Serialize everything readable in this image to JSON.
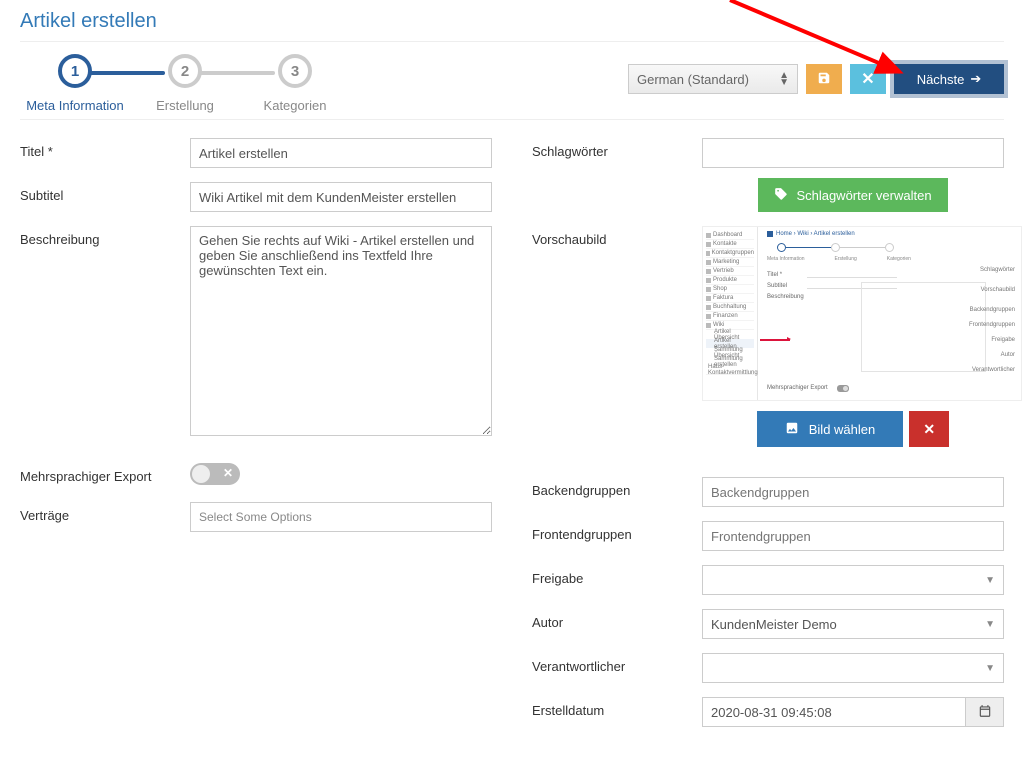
{
  "page_title": "Artikel erstellen",
  "steps": [
    {
      "num": "1",
      "label": "Meta Information",
      "active": true
    },
    {
      "num": "2",
      "label": "Erstellung",
      "active": false
    },
    {
      "num": "3",
      "label": "Kategorien",
      "active": false
    }
  ],
  "top_controls": {
    "language": "German (Standard)",
    "next_label": "Nächste"
  },
  "left": {
    "title_label": "Titel *",
    "title_value": "Artikel erstellen",
    "subtitle_label": "Subtitel",
    "subtitle_value": "Wiki Artikel mit dem KundenMeister erstellen",
    "description_label": "Beschreibung",
    "description_value": "Gehen Sie rechts auf Wiki - Artikel erstellen und geben Sie anschließend ins Textfeld Ihre gewünschten Text ein.",
    "multilang_label": "Mehrsprachiger Export",
    "contracts_label": "Verträge",
    "contracts_placeholder": "Select Some Options"
  },
  "right": {
    "tags_label": "Schlagwörter",
    "tags_manage": "Schlagwörter verwalten",
    "preview_label": "Vorschaubild",
    "choose_image": "Bild wählen",
    "backend_label": "Backendgruppen",
    "backend_placeholder": "Backendgruppen",
    "frontend_label": "Frontendgruppen",
    "frontend_placeholder": "Frontendgruppen",
    "release_label": "Freigabe",
    "release_value": "",
    "author_label": "Autor",
    "author_value": "KundenMeister Demo",
    "responsible_label": "Verantwortlicher",
    "responsible_value": "",
    "created_label": "Erstelldatum",
    "created_value": "2020-08-31 09:45:08"
  },
  "thumb": {
    "breadcrumb": "Home › Wiki › Artikel erstellen",
    "sidebar": [
      "Dashboard",
      "Kontakte",
      "Kontaktgruppen",
      "Marketing",
      "Vertrieb",
      "Produkte",
      "Shop",
      "Faktura",
      "Buchhaltung",
      "Finanzen",
      "Wiki"
    ],
    "sub": [
      "Artikel Übersicht",
      "Artikel erstellen",
      "Sammlung Übersicht",
      "Sammlung erstellen"
    ],
    "sidebar_tail": [
      "Haus-Kontaktvermittlung"
    ],
    "steps_labels": [
      "Meta Information",
      "Erstellung",
      "Kategorien"
    ],
    "form_left": [
      "Titel *",
      "Subtitel",
      "Beschreibung",
      "Mehrsprachiger Export"
    ],
    "form_right": [
      "Schlagwörter",
      "Vorschaubild",
      "Backendgruppen",
      "Frontendgruppen",
      "Freigabe",
      "Autor",
      "Verantwortlicher"
    ]
  }
}
